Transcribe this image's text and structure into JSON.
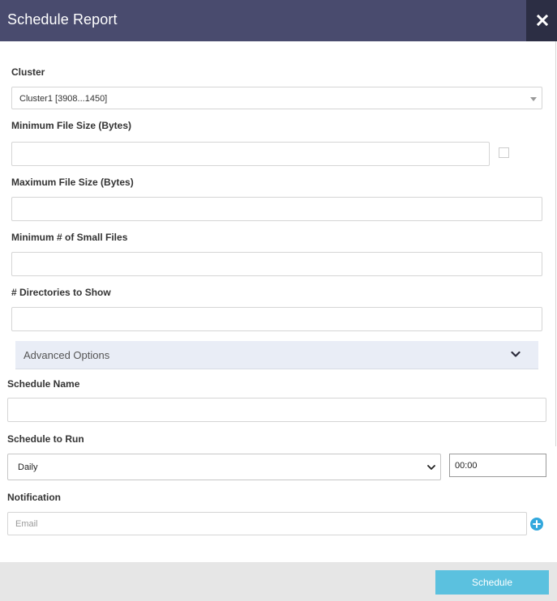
{
  "dialog": {
    "title": "Schedule Report",
    "close_icon": "close-icon"
  },
  "form": {
    "cluster": {
      "label": "Cluster",
      "value": "Cluster1 [3908...1450]"
    },
    "min_file_size": {
      "label": "Minimum File Size (Bytes)",
      "value": ""
    },
    "max_file_size": {
      "label": "Maximum File Size (Bytes)",
      "value": ""
    },
    "min_small_files": {
      "label": "Minimum # of Small Files",
      "value": ""
    },
    "dirs_to_show": {
      "label": "# Directories to Show",
      "value": ""
    },
    "advanced_options": {
      "label": "Advanced Options",
      "icon": "chevron-down-icon"
    },
    "schedule_name": {
      "label": "Schedule Name",
      "value": ""
    },
    "schedule_to_run": {
      "label": "Schedule to Run",
      "frequency": "Daily",
      "time": "00:00"
    },
    "notification": {
      "label": "Notification",
      "email_placeholder": "Email",
      "add_icon": "plus-circle-icon"
    }
  },
  "footer": {
    "schedule_label": "Schedule"
  },
  "colors": {
    "header_bg": "#494b6e",
    "close_bg": "#2c2e44",
    "advanced_bg": "#e9edf6",
    "primary_button": "#5bc1df",
    "add_icon": "#33a8dd",
    "footer_bg": "#e6e6e6"
  }
}
